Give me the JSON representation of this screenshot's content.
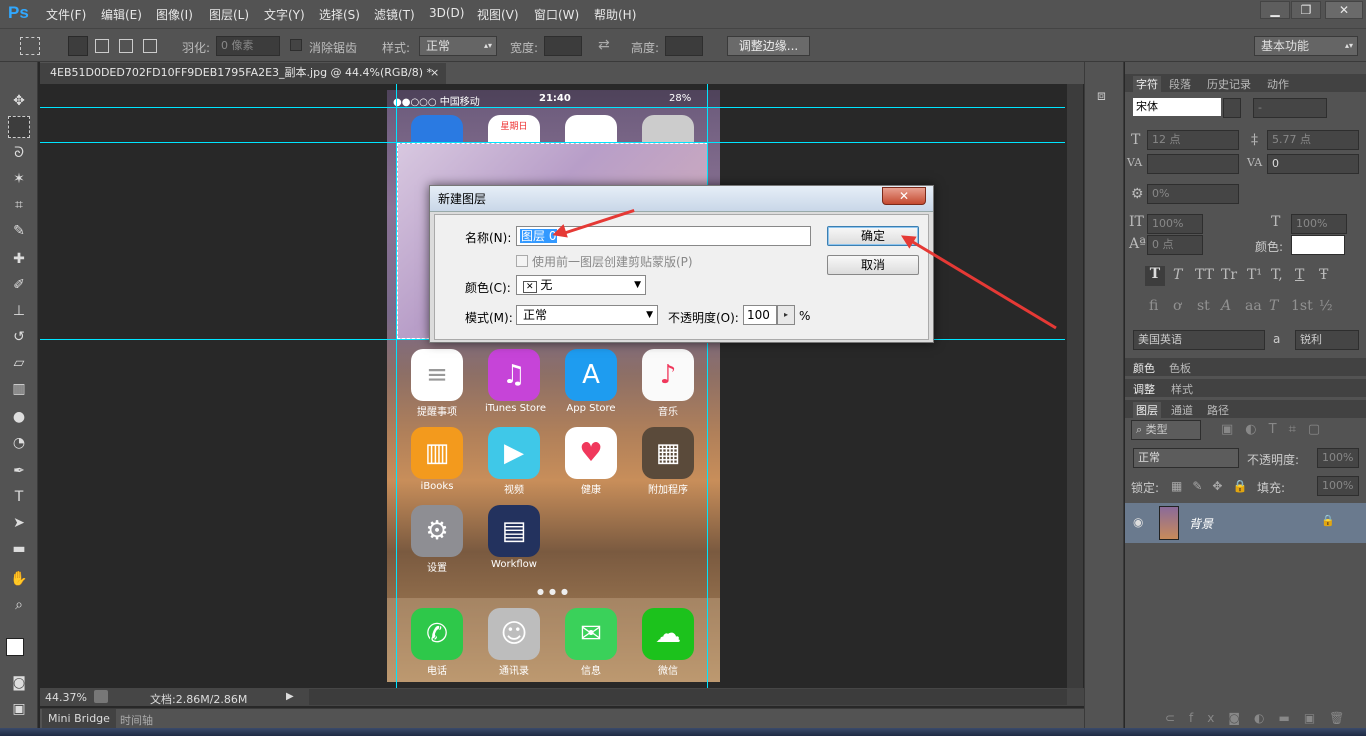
{
  "app": {
    "logo": "Ps"
  },
  "menu": [
    "文件(F)",
    "编辑(E)",
    "图像(I)",
    "图层(L)",
    "文字(Y)",
    "选择(S)",
    "滤镜(T)",
    "3D(D)",
    "视图(V)",
    "窗口(W)",
    "帮助(H)"
  ],
  "window": {
    "minimize": "▁",
    "restore": "❐",
    "close": "✕"
  },
  "options": {
    "feather_label": "羽化:",
    "feather_value": "0 像素",
    "antialias_label": "消除锯齿",
    "style_label": "样式:",
    "style_value": "正常",
    "width_label": "宽度:",
    "height_label": "高度:",
    "refine_button": "调整边缘...",
    "workspace": "基本功能"
  },
  "document": {
    "tab_title": "4EB51D0DED702FD10FF9DEB1795FA2E3_副本.jpg @ 44.4%(RGB/8) *",
    "close": "×",
    "zoom": "44.37%",
    "doc_info": "文档:2.86M/2.86M"
  },
  "bridge": {
    "tabs": [
      "Mini Bridge",
      "时间轴"
    ]
  },
  "phone": {
    "carrier": "●●○○○ 中国移动",
    "time": "21:40",
    "battery": "28%",
    "calendar_day": "星期日",
    "apps": [
      {
        "label": "提醒事项",
        "color": "#ffffff",
        "glyph": "≡"
      },
      {
        "label": "iTunes Store",
        "color": "#c644d8",
        "glyph": "♫"
      },
      {
        "label": "App Store",
        "color": "#1e9cf0",
        "glyph": "A"
      },
      {
        "label": "音乐",
        "color": "#fafafa",
        "glyph": "♪"
      },
      {
        "label": "iBooks",
        "color": "#f39a1d",
        "glyph": "▥"
      },
      {
        "label": "视频",
        "color": "#3fc8e8",
        "glyph": "▶"
      },
      {
        "label": "健康",
        "color": "#ffffff",
        "glyph": "♥"
      },
      {
        "label": "附加程序",
        "color": "#5a4a3a",
        "glyph": "▦"
      },
      {
        "label": "设置",
        "color": "#8e8e93",
        "glyph": "⚙"
      },
      {
        "label": "Workflow",
        "color": "#23325e",
        "glyph": "▤"
      }
    ],
    "dock": [
      {
        "label": "电话",
        "color": "#2ec84a",
        "glyph": "✆"
      },
      {
        "label": "通讯录",
        "color": "#bdbdbd",
        "glyph": "☺"
      },
      {
        "label": "信息",
        "color": "#3ad15a",
        "glyph": "✉"
      },
      {
        "label": "微信",
        "color": "#1cc21c",
        "glyph": "☁"
      }
    ]
  },
  "dialog": {
    "title": "新建图层",
    "close": "✕",
    "name_label": "名称(N):",
    "name_value": "图层 0",
    "clip_label": "使用前一图层创建剪贴蒙版(P)",
    "color_label": "颜色(C):",
    "color_value": "无",
    "mode_label": "模式(M):",
    "mode_value": "正常",
    "opacity_label": "不透明度(O):",
    "opacity_value": "100",
    "percent": "%",
    "ok": "确定",
    "cancel": "取消"
  },
  "char_panel": {
    "tabs": [
      "字符",
      "段落",
      "历史记录",
      "动作"
    ],
    "font": "宋体",
    "size": "12 点",
    "leading": "5.77 点",
    "tracking": "0",
    "scale_h": "0%",
    "scale_v1": "100%",
    "scale_v2": "100%",
    "baseline": "0 点",
    "color_label": "颜色:",
    "language": "美国英语",
    "aa_label": "a",
    "aa_value": "锐利",
    "style_glyphs": [
      "T",
      "T",
      "TT",
      "Tr",
      "T¹",
      "T,",
      "T",
      "Ŧ"
    ],
    "otf_glyphs": [
      "fi",
      "ơ",
      "st",
      "A",
      "aa",
      "T",
      "1st",
      "½"
    ]
  },
  "color_panel": {
    "tabs": [
      "颜色",
      "色板"
    ]
  },
  "adjust_panel": {
    "tabs": [
      "调整",
      "样式"
    ]
  },
  "layers_panel": {
    "tabs": [
      "图层",
      "通道",
      "路径"
    ],
    "filter": "类型",
    "blend": "正常",
    "opacity_label": "不透明度:",
    "opacity_value": "100%",
    "lock_label": "锁定:",
    "fill_label": "填充:",
    "fill_value": "100%",
    "layer_name": "背景"
  }
}
